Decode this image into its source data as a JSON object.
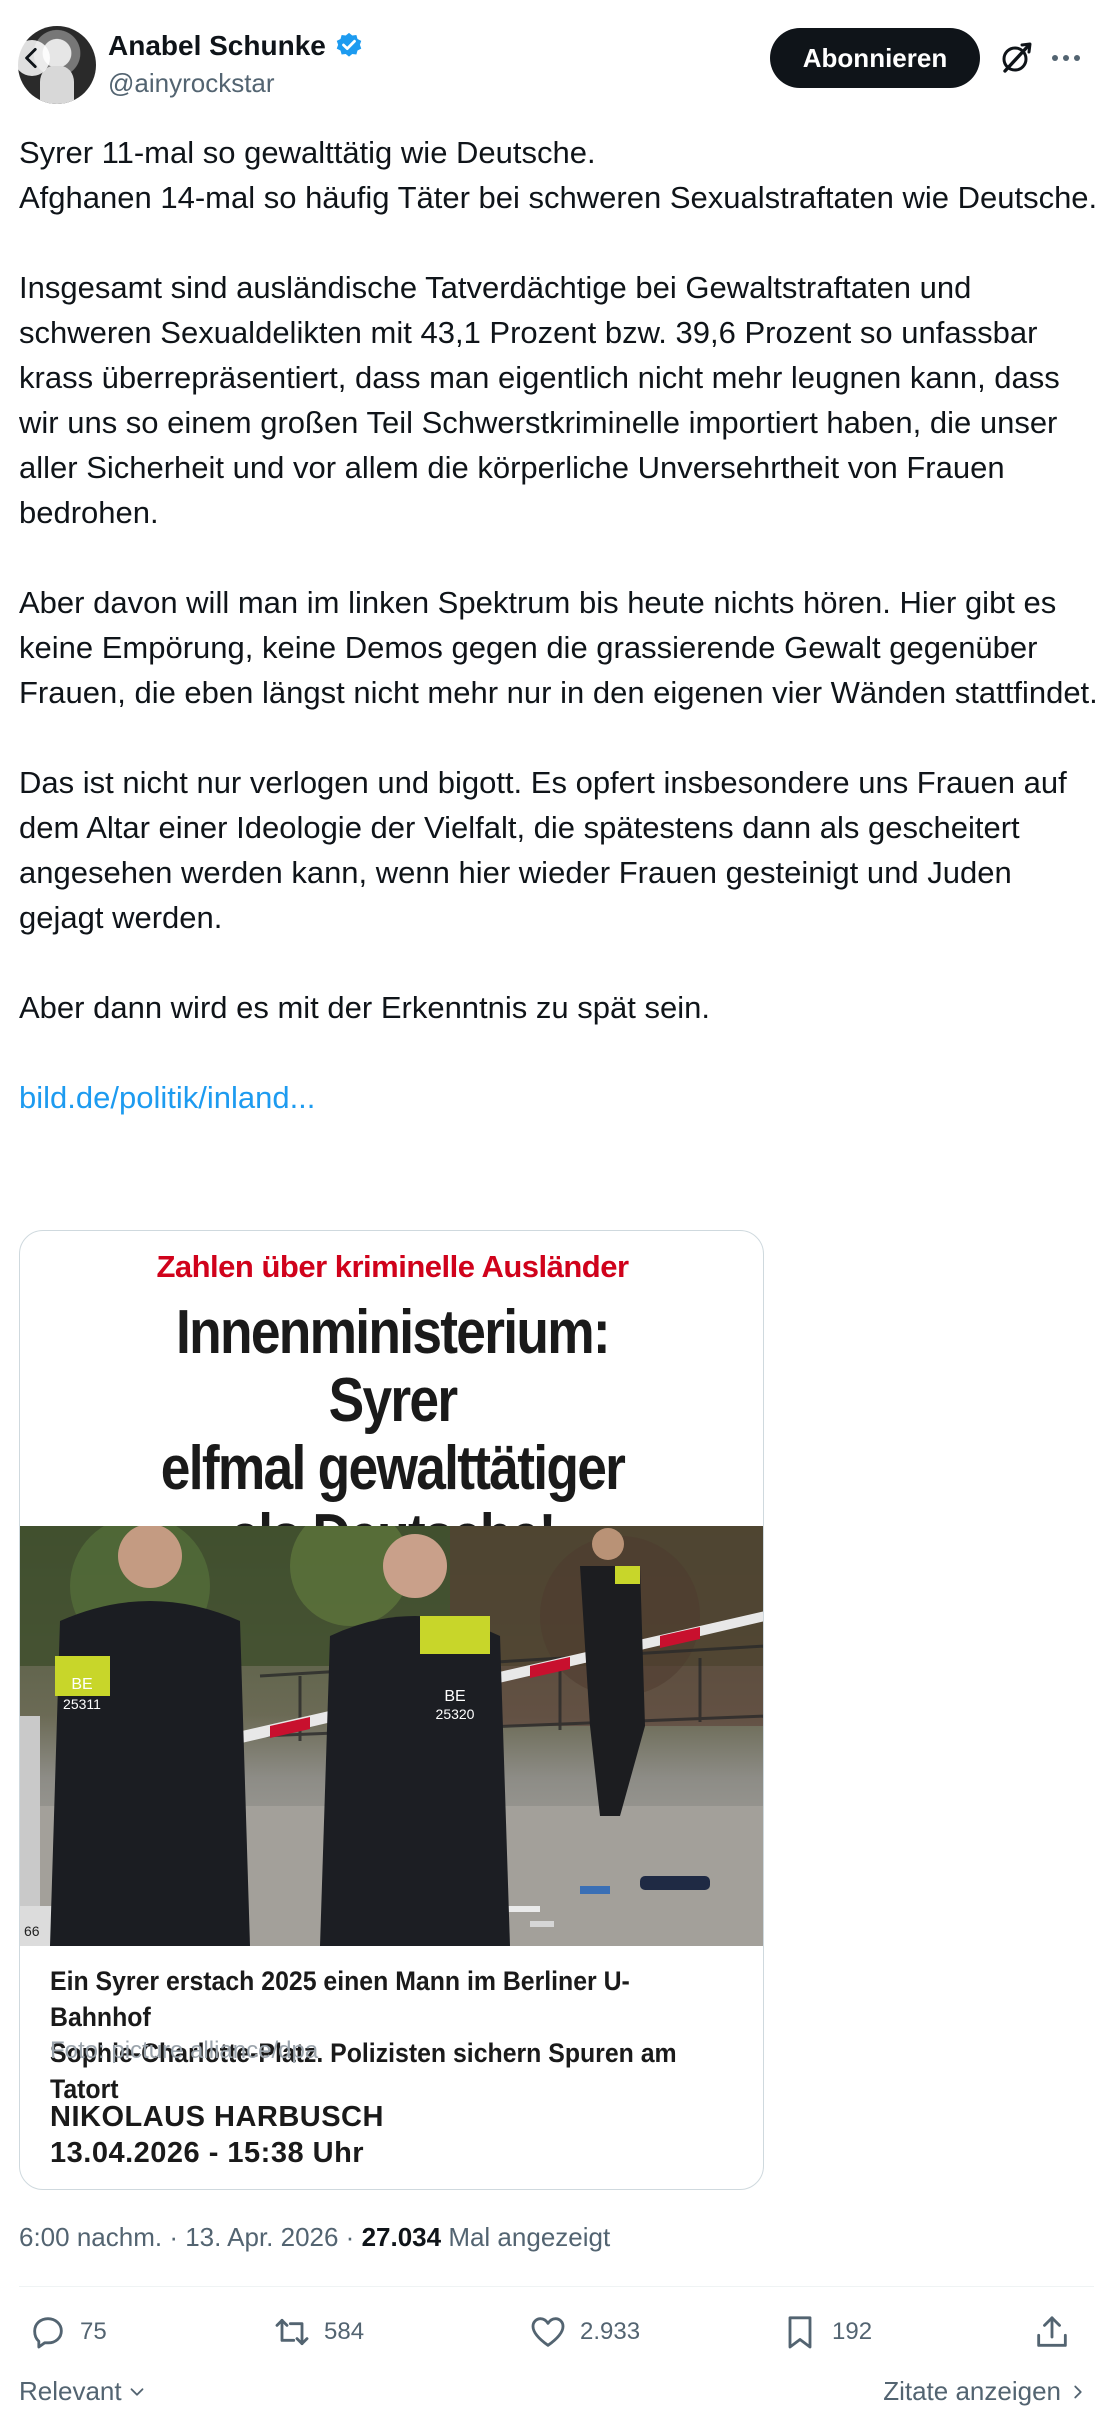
{
  "header": {
    "author_name": "Anabel Schunke",
    "author_handle": "@ainyrockstar",
    "follow_label": "Abonnieren"
  },
  "tweet": {
    "paragraphs": [
      [
        "Syrer 11-mal so gewalttätig wie Deutsche.",
        "Afghanen 14-mal so häufig Täter bei schweren Sexualstraftaten wie Deutsche."
      ],
      [
        "Insgesamt sind ausländische Tatverdächtige bei Gewaltstraftaten und schweren Sexualdelikten mit 43,1 Prozent bzw. 39,6 Prozent so unfassbar krass überrepräsentiert, dass man eigentlich nicht mehr leugnen kann, dass wir uns so einem großen Teil Schwerstkriminelle importiert haben, die unser aller Sicherheit und vor allem die körperliche Unversehrtheit von Frauen bedrohen."
      ],
      [
        "Aber davon will man im linken Spektrum bis heute nichts hören. Hier gibt es keine Empörung, keine Demos gegen die grassierende Gewalt gegenüber Frauen, die eben längst nicht mehr nur in den eigenen vier Wänden stattfindet."
      ],
      [
        "Das ist nicht nur verlogen und bigott. Es opfert insbesondere uns Frauen auf dem Altar einer Ideologie der Vielfalt, die spätestens dann als gescheitert angesehen werden kann, wenn hier wieder Frauen gesteinigt und Juden gejagt werden."
      ],
      [
        "Aber dann wird es mit der Erkenntnis zu spät sein."
      ]
    ],
    "p1_line1": "Syrer 11-mal so gewalttätig wie Deutsche.",
    "p1_line2": "Afghanen 14-mal so häufig Täter bei schweren Sexualstraftaten wie Deutsche.",
    "p2": "Insgesamt sind ausländische Tatverdächtige bei Gewaltstraftaten und schweren Sexualdelikten mit 43,1 Prozent bzw. 39,6 Prozent so unfassbar krass überrepräsentiert, dass man eigentlich nicht mehr leugnen kann, dass wir uns so einem großen Teil Schwerstkriminelle importiert haben, die unser aller Sicherheit und vor allem die körperliche Unversehrtheit von Frauen bedrohen.",
    "p3": "Aber davon will man im linken Spektrum bis heute nichts hören. Hier gibt es keine Empörung, keine Demos gegen die grassierende Gewalt gegenüber Frauen, die eben längst nicht mehr nur in den eigenen vier Wänden stattfindet.",
    "p4": "Das ist nicht nur verlogen und bigott. Es opfert insbesondere uns Frauen auf dem Altar einer Ideologie der Vielfalt, die spätestens dann als gescheitert angesehen werden kann, wenn hier wieder Frauen gesteinigt und Juden gejagt werden.",
    "p5": "Aber dann wird es mit der Erkenntnis zu spät sein.",
    "link_text": "bild.de/politik/inland..."
  },
  "card": {
    "kicker": "Zahlen über kriminelle Ausländer",
    "headline_1": "Innenministerium: Syrer",
    "headline_2": "elfmal gewalttätiger",
    "headline_3": "als Deutsche!",
    "caption_1": "Ein Syrer erstach 2025 einen Mann im Berliner U-Bahnhof",
    "caption_2": "Sophie-Charlotte-Platz. Polizisten sichern Spuren am Tatort",
    "credit": "Foto: picture alliance/dpa",
    "author": "NIKOLAUS HARBUSCH",
    "datetime": "13.04.2026 - 15:38 Uhr",
    "vest_left_1": "BE",
    "vest_left_2": "25311",
    "vest_right_1": "BE",
    "vest_right_2": "25320",
    "car_number": "66"
  },
  "meta": {
    "time": "6:00 nachm.",
    "sep1": " · ",
    "date": "13. Apr. 2026",
    "sep2": " · ",
    "views": "27.034",
    "views_label": " Mal angezeigt"
  },
  "actions": {
    "replies": "75",
    "reposts": "584",
    "likes": "2.933",
    "bookmarks": "192"
  },
  "footer": {
    "sort_label": "Relevant",
    "quotes_label": "Zitate anzeigen"
  },
  "colors": {
    "text": "#0f1419",
    "secondary": "#536471",
    "link": "#1d9bf0",
    "verified": "#1d9bf0",
    "kicker_red": "#d0021b"
  }
}
